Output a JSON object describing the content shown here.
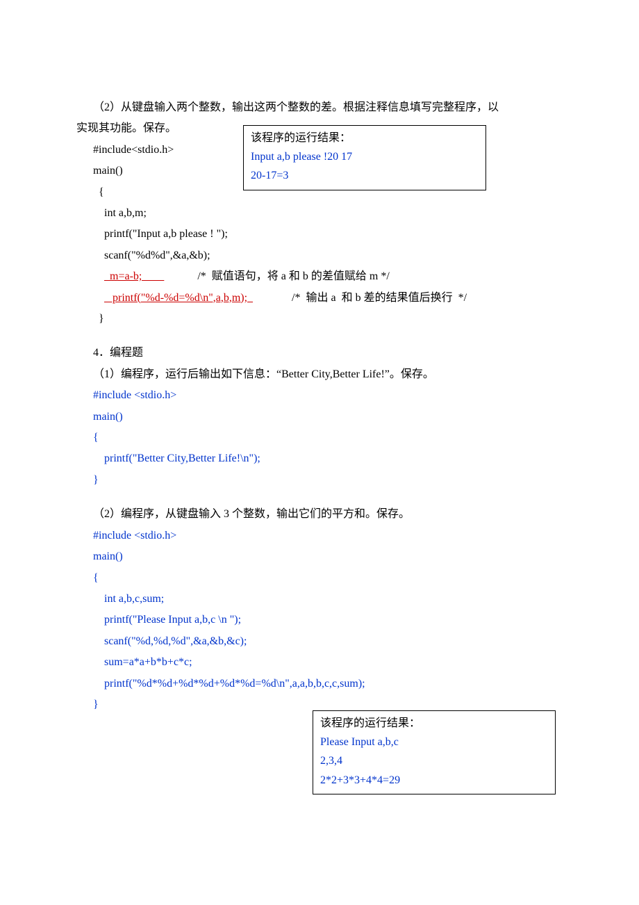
{
  "p1": {
    "intro1": "　　（2）从键盘输入两个整数，输出这两个整数的差。根据注释信息填写完整程序，以",
    "intro2": "实现其功能。保存。",
    "c1": "#include<stdio.h>",
    "c2": "main()",
    "c3": "  {",
    "c4": "    int a,b,m;",
    "c5": "    printf(\"Input a,b please ! \");",
    "c6": "    scanf(\"%d%d\",&a,&b);",
    "c7a": "    ",
    "c7b": "  m=a-b;        ",
    "c7c": "            /*  赋值语句，将 a 和 b 的差值赋给 m */",
    "c8a": "    ",
    "c8b": "   printf(\"%d-%d=%d\\n\",a,b,m);  ",
    "c8c": "              /*  输出 a  和 b 差的结果值后换行  */",
    "c9": "  }"
  },
  "box1": {
    "title": "该程序的运行结果：",
    "l1": "Input a,b please !20 17",
    "l2": "20-17=3"
  },
  "p2": {
    "title": "4．编程题",
    "intro": "（1）编程序，运行后输出如下信息：“Better City,Better Life!”。保存。",
    "c1": "#include <stdio.h>",
    "c2": "main()",
    "c3": "{",
    "c4": "    printf(\"Better City,Better Life!\\n\");",
    "c5": "}"
  },
  "p3": {
    "intro": "（2）编程序，从键盘输入 3 个整数，输出它们的平方和。保存。",
    "c1": "#include <stdio.h>",
    "c2": "main()",
    "c3": "{",
    "c4": "    int a,b,c,sum;",
    "c5": "    printf(\"Please Input a,b,c \\n \");",
    "c6": "    scanf(\"%d,%d,%d\",&a,&b,&c);",
    "c7": "    sum=a*a+b*b+c*c;",
    "c8": "    printf(\"%d*%d+%d*%d+%d*%d=%d\\n\",a,a,b,b,c,c,sum);",
    "c9": "}"
  },
  "box2": {
    "title": "该程序的运行结果：",
    "l1": "Please Input a,b,c",
    "l2": "2,3,4",
    "l3": "2*2+3*3+4*4=29"
  }
}
